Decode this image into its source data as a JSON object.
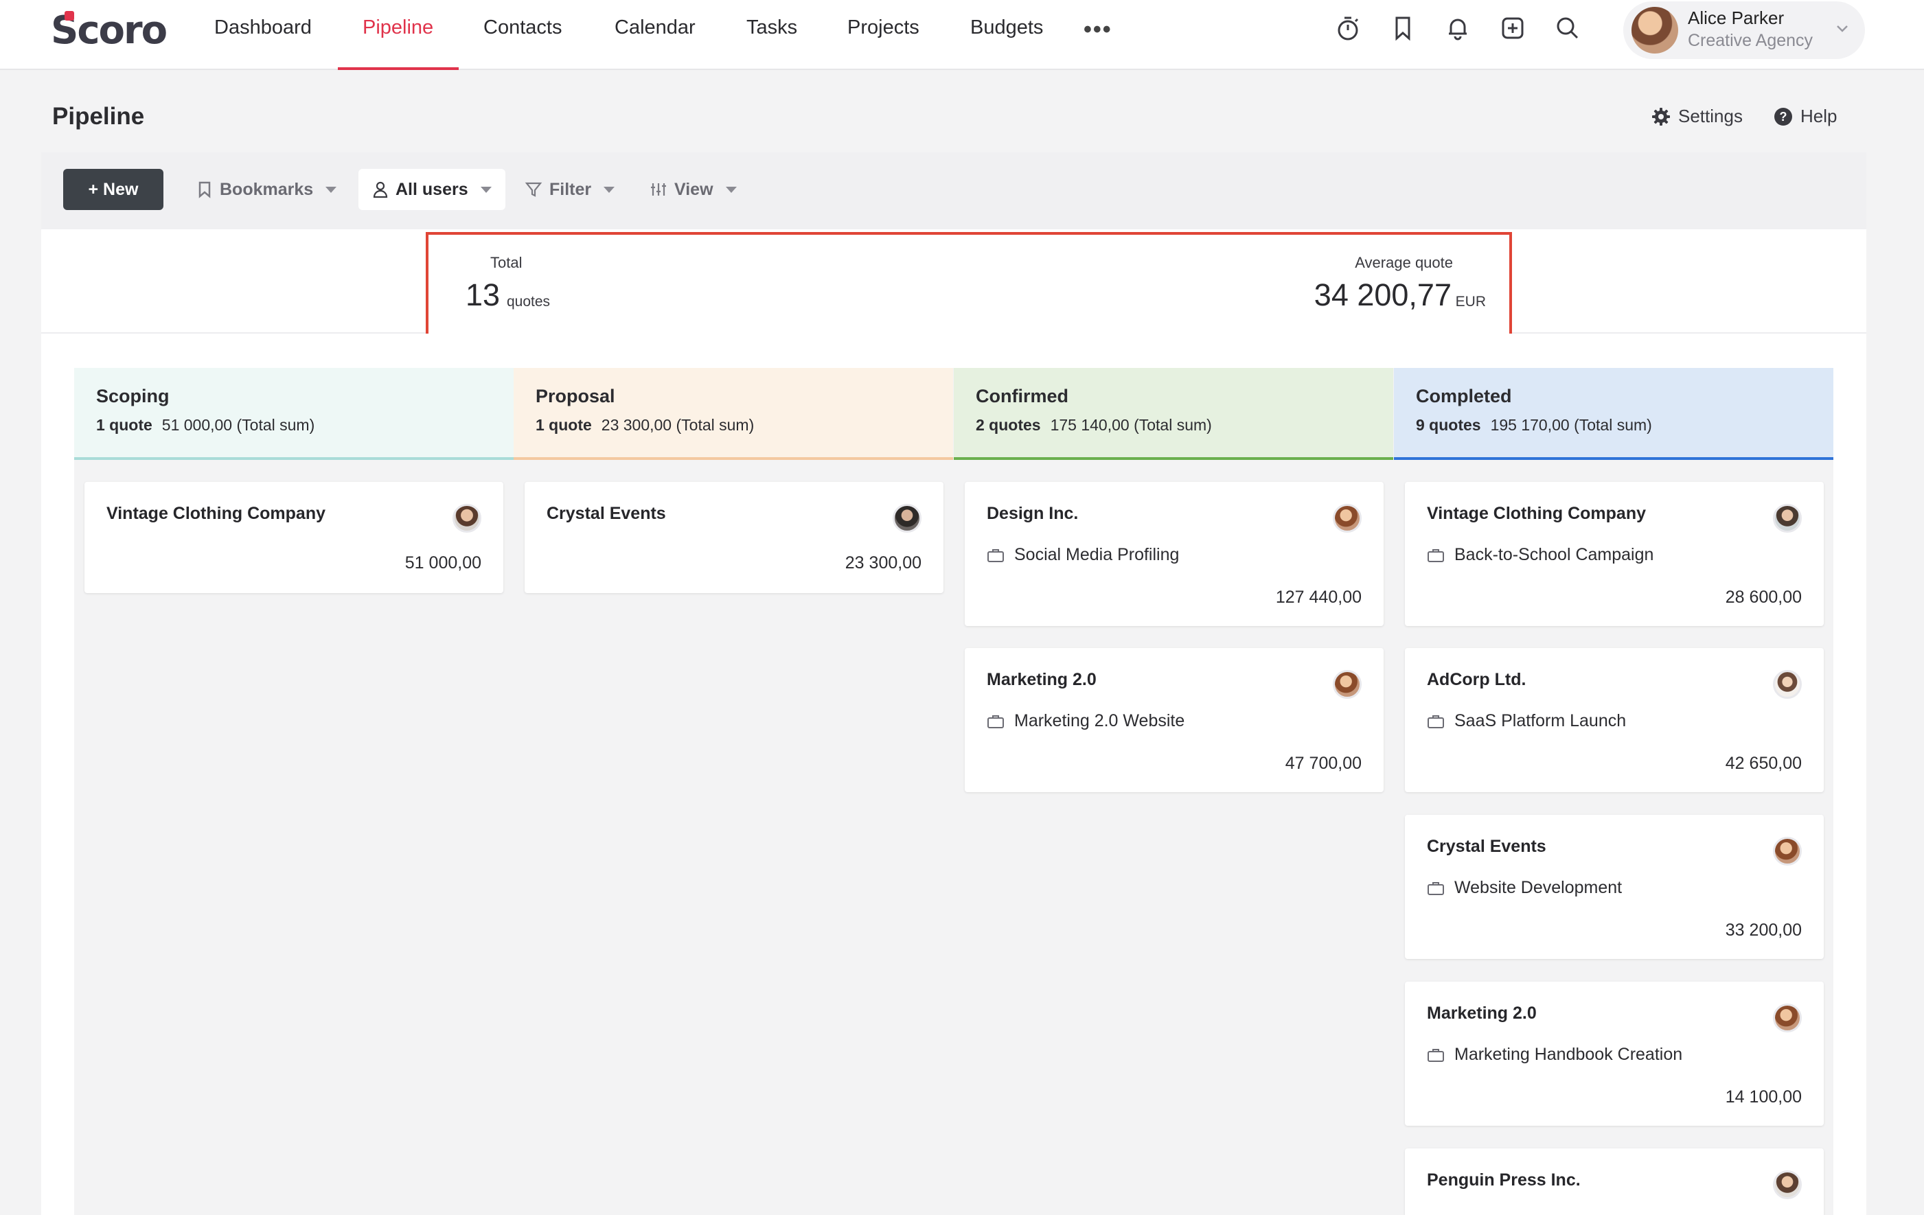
{
  "app": {
    "logo": "Scoro"
  },
  "nav": {
    "items": [
      {
        "label": "Dashboard"
      },
      {
        "label": "Pipeline"
      },
      {
        "label": "Contacts"
      },
      {
        "label": "Calendar"
      },
      {
        "label": "Tasks"
      },
      {
        "label": "Projects"
      },
      {
        "label": "Budgets"
      }
    ],
    "active": "Pipeline",
    "more_label": "•••"
  },
  "top_icons": [
    "timer-icon",
    "bookmark-icon",
    "bell-icon",
    "add-square-icon",
    "search-icon"
  ],
  "user": {
    "name": "Alice Parker",
    "org": "Creative Agency"
  },
  "page": {
    "title": "Pipeline",
    "settings_label": "Settings",
    "help_label": "Help"
  },
  "toolbar": {
    "new_label": "+ New",
    "bookmarks_label": "Bookmarks",
    "users_label": "All users",
    "filter_label": "Filter",
    "view_label": "View"
  },
  "summary": {
    "total_label": "Total",
    "total_value": "13",
    "total_unit": "quotes",
    "avg_label": "Average quote",
    "avg_value": "34 200,77",
    "avg_unit": "EUR"
  },
  "columns": [
    {
      "title": "Scoping",
      "count": "1 quote",
      "sum": "51 000,00 (Total sum)",
      "bg": "#eef8f6",
      "line": "#a9dcd8"
    },
    {
      "title": "Proposal",
      "count": "1 quote",
      "sum": "23 300,00 (Total sum)",
      "bg": "#fcf2e6",
      "line": "#f4c9a0"
    },
    {
      "title": "Confirmed",
      "count": "2 quotes",
      "sum": "175 140,00 (Total sum)",
      "bg": "#e6f1e0",
      "line": "#6bb04e"
    },
    {
      "title": "Completed",
      "count": "9 quotes",
      "sum": "195 170,00 (Total sum)",
      "bg": "#dce8f7",
      "line": "#2f73d8"
    }
  ],
  "cards": {
    "scoping": [
      {
        "title": "Vintage Clothing Company",
        "amount": "51 000,00"
      }
    ],
    "proposal": [
      {
        "title": "Crystal Events",
        "amount": "23 300,00"
      }
    ],
    "confirmed": [
      {
        "title": "Design Inc.",
        "project": "Social Media Profiling",
        "amount": "127 440,00"
      },
      {
        "title": "Marketing 2.0",
        "project": "Marketing 2.0 Website",
        "amount": "47 700,00"
      }
    ],
    "completed": [
      {
        "title": "Vintage Clothing Company",
        "project": "Back-to-School Campaign",
        "amount": "28 600,00"
      },
      {
        "title": "AdCorp Ltd.",
        "project": "SaaS Platform Launch",
        "amount": "42 650,00"
      },
      {
        "title": "Crystal Events",
        "project": "Website Development",
        "amount": "33 200,00"
      },
      {
        "title": "Marketing 2.0",
        "project": "Marketing Handbook Creation",
        "amount": "14 100,00"
      },
      {
        "title": "Penguin Press Inc."
      }
    ]
  }
}
